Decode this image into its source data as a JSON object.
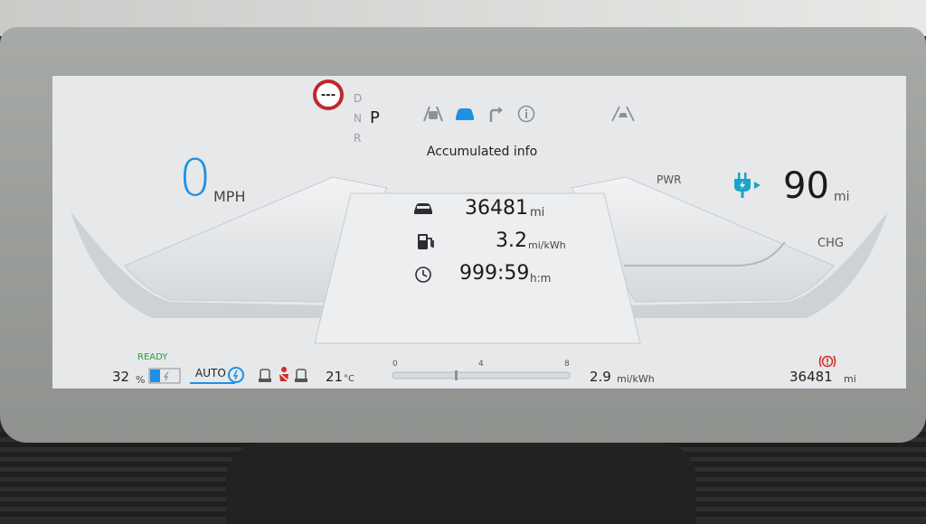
{
  "cluster": {
    "speed": {
      "value": "0",
      "unit": "MPH"
    },
    "gears": {
      "d": "D",
      "n": "N",
      "r": "R",
      "selected": "P"
    },
    "speed_limit_sign": "---",
    "panel_title": "Accumulated info",
    "stats": [
      {
        "icon": "car-icon",
        "value": "36481",
        "unit": "mi"
      },
      {
        "icon": "fuel-charger-icon",
        "value": "3.2",
        "unit": "mi/kWh"
      },
      {
        "icon": "clock-icon",
        "value": "999:59",
        "unit": "h:m"
      }
    ],
    "range": {
      "value": "90",
      "unit": "mi"
    },
    "power_label": "PWR",
    "charge_label": "CHG",
    "bottom": {
      "ready": "READY",
      "battery_percent": "32",
      "battery_unit": "%",
      "auto_label": "AUTO",
      "temperature": "21",
      "temperature_unit": "°C",
      "scale_labels": [
        "0",
        "4",
        "8"
      ],
      "efficiency_value": "2.9",
      "efficiency_unit": "mi/kWh",
      "odometer_value": "36481",
      "odometer_unit": "mi"
    }
  },
  "colors": {
    "accent_blue": "#1e90e6",
    "ready_green": "#2e9b3c",
    "alert_red": "#d22a2a",
    "charge_teal": "#1aa3c7"
  }
}
